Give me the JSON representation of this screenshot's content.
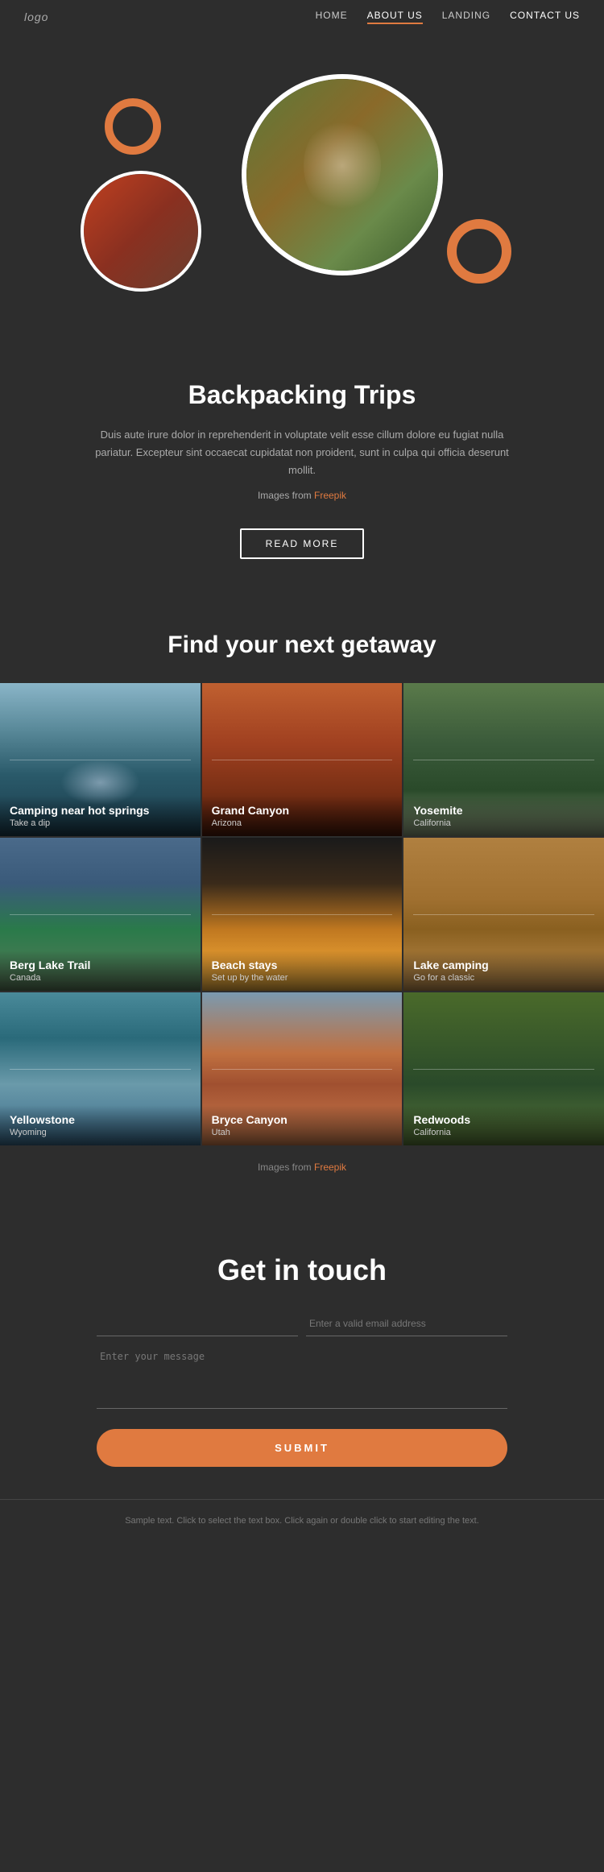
{
  "nav": {
    "logo": "logo",
    "links": [
      {
        "label": "HOME",
        "active": false
      },
      {
        "label": "ABOUT US",
        "active": true
      },
      {
        "label": "LANDING",
        "active": false
      },
      {
        "label": "CONTACT US",
        "active": false
      }
    ]
  },
  "hero": {
    "alt_main": "Person sitting near tent camping",
    "alt_small": "Two people taking a selfie camping"
  },
  "about": {
    "title": "Backpacking Trips",
    "description": "Duis aute irure dolor in reprehenderit in voluptate velit esse cillum dolore eu fugiat nulla pariatur. Excepteur sint occaecat cupidatat non proident, sunt in culpa qui officia deserunt mollit.",
    "freepik_text": "Images from",
    "freepik_link": "Freepik",
    "read_more": "READ MORE"
  },
  "getaway": {
    "title": "Find your next getaway",
    "items": [
      {
        "name": "Camping near hot springs",
        "subtitle": "Take a dip",
        "bg_class": "bg-hot-springs"
      },
      {
        "name": "Grand Canyon",
        "subtitle": "Arizona",
        "bg_class": "bg-grand-canyon"
      },
      {
        "name": "Yosemite",
        "subtitle": "California",
        "bg_class": "bg-yosemite"
      },
      {
        "name": "Berg Lake Trail",
        "subtitle": "Canada",
        "bg_class": "bg-berg-lake"
      },
      {
        "name": "Beach stays",
        "subtitle": "Set up by the water",
        "bg_class": "bg-beach-stays"
      },
      {
        "name": "Lake camping",
        "subtitle": "Go for a classic",
        "bg_class": "bg-lake-camping"
      },
      {
        "name": "Yellowstone",
        "subtitle": "Wyoming",
        "bg_class": "bg-yellowstone"
      },
      {
        "name": "Bryce Canyon",
        "subtitle": "Utah",
        "bg_class": "bg-bryce-canyon"
      },
      {
        "name": "Redwoods",
        "subtitle": "California",
        "bg_class": "bg-redwoods"
      }
    ],
    "freepik_text": "Images from",
    "freepik_link": "Freepik"
  },
  "contact": {
    "title": "Get in touch",
    "name_placeholder": "",
    "email_placeholder": "Enter a valid email address",
    "message_placeholder": "Enter your message",
    "submit_label": "SUBMIT"
  },
  "footer": {
    "text": "Sample text. Click to select the text box. Click again or double click to start editing the text."
  }
}
